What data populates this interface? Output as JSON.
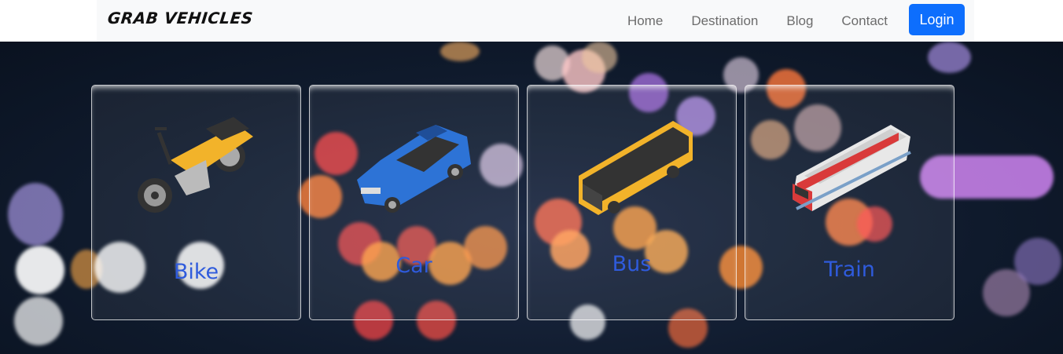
{
  "navbar": {
    "brand": "GRAB VEHICLES",
    "links": [
      "Home",
      "Destination",
      "Blog",
      "Contact"
    ],
    "login_label": "Login"
  },
  "vehicles": [
    {
      "label": "Bike",
      "icon": "motorcycle-icon"
    },
    {
      "label": "Car",
      "icon": "car-icon"
    },
    {
      "label": "Bus",
      "icon": "bus-icon"
    },
    {
      "label": "Train",
      "icon": "train-icon"
    }
  ],
  "colors": {
    "login_bg": "#0d6efd",
    "card_label": "#2f5bdc",
    "navbar_bg": "#f8f9fa"
  }
}
